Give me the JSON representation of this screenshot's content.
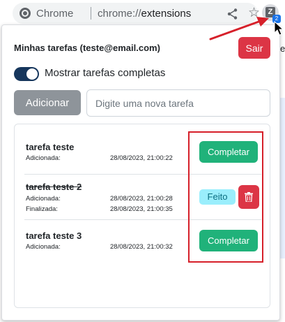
{
  "browser": {
    "app_name": "Chrome",
    "url_scheme": "chrome://",
    "url_path": "extensions",
    "extension_icon_letter": "Z",
    "extension_badge": "2"
  },
  "popup": {
    "user_title": "Minhas tarefas (teste@email.com)",
    "logout_label": "Sair",
    "toggle_label": "Mostrar tarefas completas",
    "toggle_on": true,
    "add_label": "Adicionar",
    "input_placeholder": "Digite uma nova tarefa",
    "input_value": ""
  },
  "tasks": [
    {
      "name": "tarefa teste",
      "added_label": "Adicionada:",
      "added_at": "28/08/2023, 21:00:22",
      "done": false,
      "action_label": "Completar"
    },
    {
      "name": "tarefa teste 2",
      "added_label": "Adicionada:",
      "added_at": "28/08/2023, 21:00:28",
      "finished_label": "Finalizada:",
      "finished_at": "28/08/2023, 21:00:35",
      "done": true,
      "status_label": "Feito"
    },
    {
      "name": "tarefa teste 3",
      "added_label": "Adicionada:",
      "added_at": "28/08/2023, 21:00:32",
      "done": false,
      "action_label": "Completar"
    }
  ],
  "colors": {
    "danger": "#dc3545",
    "success": "#20b27a",
    "info": "#9aeefc",
    "secondary": "#8e949a",
    "annotation": "#d6202a"
  }
}
